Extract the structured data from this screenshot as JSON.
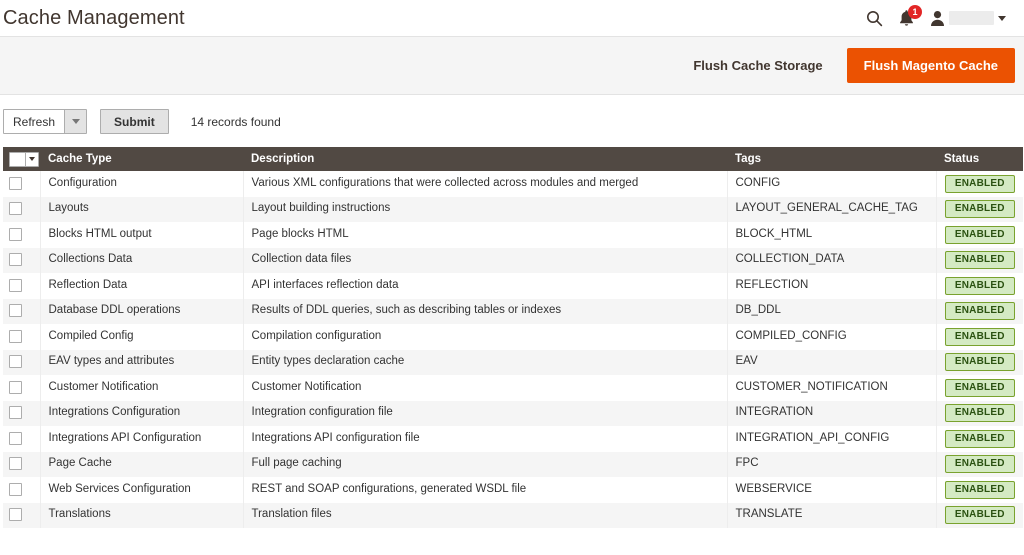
{
  "header": {
    "title": "Cache Management",
    "search_icon": "search-icon",
    "notifications_icon": "bell-icon",
    "notifications_count": "1",
    "user_icon": "user-icon",
    "user_name": "",
    "user_caret_icon": "chevron-down-icon"
  },
  "page_actions": {
    "flush_cache_storage_label": "Flush Cache Storage",
    "flush_magento_cache_label": "Flush Magento Cache",
    "primary_color": "#eb5202"
  },
  "toolbar": {
    "mass_action_selected": "Refresh",
    "mass_action_caret_icon": "chevron-down-icon",
    "submit_label": "Submit",
    "records_found": "14 records found"
  },
  "grid": {
    "select_all_icon": "checkbox-dropdown-icon",
    "columns": [
      {
        "key": "check",
        "label": ""
      },
      {
        "key": "type",
        "label": "Cache Type"
      },
      {
        "key": "desc",
        "label": "Description"
      },
      {
        "key": "tags",
        "label": "Tags"
      },
      {
        "key": "status",
        "label": "Status"
      }
    ],
    "rows": [
      {
        "type": "Configuration",
        "desc": "Various XML configurations that were collected across modules and merged",
        "tags": "CONFIG",
        "status": "ENABLED"
      },
      {
        "type": "Layouts",
        "desc": "Layout building instructions",
        "tags": "LAYOUT_GENERAL_CACHE_TAG",
        "status": "ENABLED"
      },
      {
        "type": "Blocks HTML output",
        "desc": "Page blocks HTML",
        "tags": "BLOCK_HTML",
        "status": "ENABLED"
      },
      {
        "type": "Collections Data",
        "desc": "Collection data files",
        "tags": "COLLECTION_DATA",
        "status": "ENABLED"
      },
      {
        "type": "Reflection Data",
        "desc": "API interfaces reflection data",
        "tags": "REFLECTION",
        "status": "ENABLED"
      },
      {
        "type": "Database DDL operations",
        "desc": "Results of DDL queries, such as describing tables or indexes",
        "tags": "DB_DDL",
        "status": "ENABLED"
      },
      {
        "type": "Compiled Config",
        "desc": "Compilation configuration",
        "tags": "COMPILED_CONFIG",
        "status": "ENABLED"
      },
      {
        "type": "EAV types and attributes",
        "desc": "Entity types declaration cache",
        "tags": "EAV",
        "status": "ENABLED"
      },
      {
        "type": "Customer Notification",
        "desc": "Customer Notification",
        "tags": "CUSTOMER_NOTIFICATION",
        "status": "ENABLED"
      },
      {
        "type": "Integrations Configuration",
        "desc": "Integration configuration file",
        "tags": "INTEGRATION",
        "status": "ENABLED"
      },
      {
        "type": "Integrations API Configuration",
        "desc": "Integrations API configuration file",
        "tags": "INTEGRATION_API_CONFIG",
        "status": "ENABLED"
      },
      {
        "type": "Page Cache",
        "desc": "Full page caching",
        "tags": "FPC",
        "status": "ENABLED"
      },
      {
        "type": "Web Services Configuration",
        "desc": "REST and SOAP configurations, generated WSDL file",
        "tags": "WEBSERVICE",
        "status": "ENABLED"
      },
      {
        "type": "Translations",
        "desc": "Translation files",
        "tags": "TRANSLATE",
        "status": "ENABLED"
      }
    ]
  },
  "colors": {
    "header_row_bg": "#514943",
    "badge_bg": "#d4eac3",
    "badge_border": "#79a22e",
    "badge_text": "#2b5211",
    "accent": "#eb5202",
    "notification_badge": "#e22626"
  }
}
